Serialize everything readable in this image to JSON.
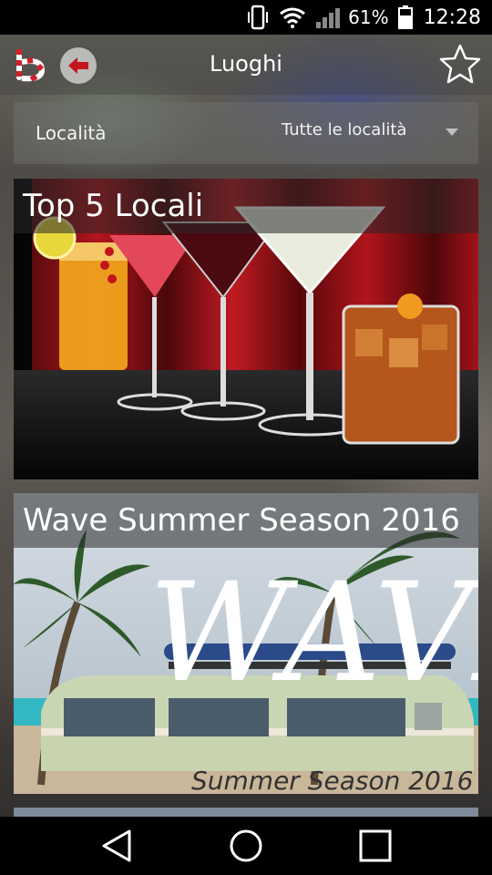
{
  "status_bar": {
    "battery_percent": "61%",
    "time": "12:28",
    "icons": [
      "vibrate-icon",
      "wifi-icon",
      "signal-icon",
      "battery-icon"
    ]
  },
  "header": {
    "title": "Luoghi",
    "logo_icon": "app-logo",
    "back_icon": "back-arrow-icon",
    "favorite_icon": "star-icon"
  },
  "filter": {
    "label": "Località",
    "selected_value": "Tutte le località"
  },
  "cards": [
    {
      "title": "Top 5 Locali"
    },
    {
      "title": "Wave Summer Season 2016",
      "art_word": "WAVE",
      "art_subtitle": "Summer Season 2016"
    }
  ],
  "nav_bar": {
    "icons": [
      "back-triangle-icon",
      "home-circle-icon",
      "recents-square-icon"
    ]
  },
  "colors": {
    "accent_red": "#d0202a",
    "status_bar_bg": "#000000",
    "nav_bar_bg": "#000000"
  }
}
